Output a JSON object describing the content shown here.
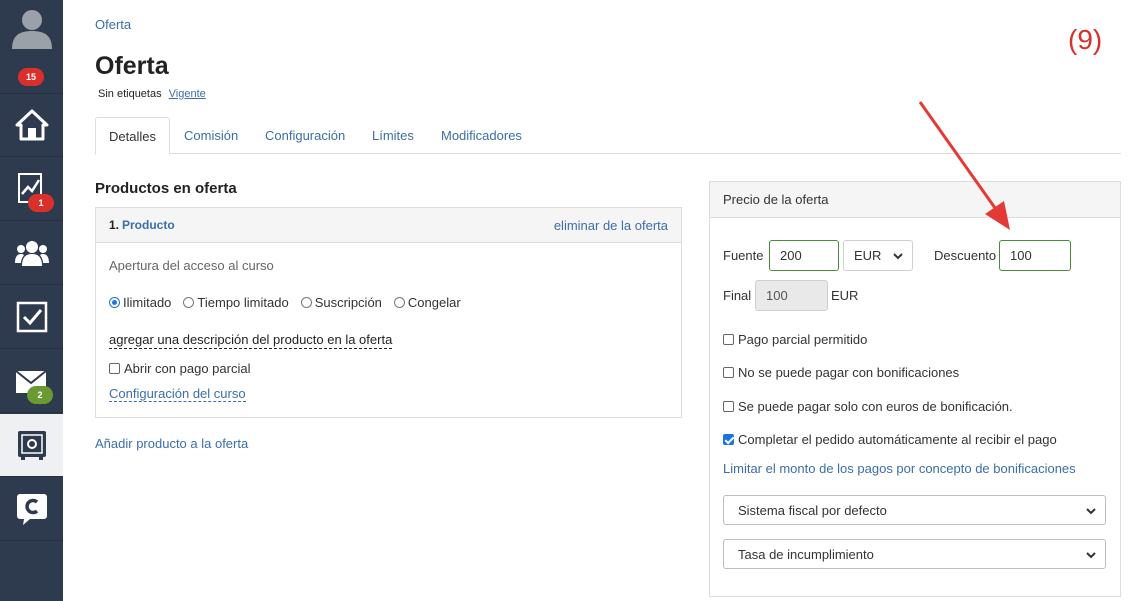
{
  "sidebar": {
    "items": [
      {
        "icon": "user-avatar-icon",
        "badge": "15",
        "badge_color": "#d9302c"
      },
      {
        "icon": "home-icon",
        "badge": ""
      },
      {
        "icon": "chart-trend-icon",
        "badge": "1",
        "badge_color": "#d9302c"
      },
      {
        "icon": "users-group-icon",
        "badge": ""
      },
      {
        "icon": "checkbox-task-icon",
        "badge": ""
      },
      {
        "icon": "envelope-icon",
        "badge": "2",
        "badge_color": "#6a9a32"
      },
      {
        "icon": "safe-icon",
        "badge": "",
        "active": true
      },
      {
        "icon": "chat-c-icon",
        "badge": ""
      }
    ]
  },
  "breadcrumb": "Oferta",
  "header": {
    "title": "Oferta",
    "tags": "Sin etiquetas",
    "status": "Vigente"
  },
  "annotation": "(9)",
  "tabs": [
    "Detalles",
    "Comisión",
    "Configuración",
    "Límites",
    "Modificadores"
  ],
  "products": {
    "section_title": "Productos en oferta",
    "item": {
      "number": "1.",
      "name": "Producto",
      "remove_label": "eliminar de la oferta",
      "access_label": "Apertura del acceso al curso",
      "access_options": [
        "Ilimitado",
        "Tiempo limitado",
        "Suscripción",
        "Congelar"
      ],
      "selected_option": "Ilimitado",
      "description_link": "agregar una descripción del producto en la oferta",
      "partial_payment_label": "Abrir con pago parcial",
      "partial_payment_checked": false,
      "course_settings_link": "Configuración del curso"
    },
    "add_product": "Añadir producto a la oferta"
  },
  "price": {
    "title": "Precio de la oferta",
    "source_label": "Fuente",
    "source_value": "200",
    "currency": "EUR",
    "discount_label": "Descuento",
    "discount_value": "100",
    "final_label": "Final",
    "final_value": "100",
    "final_currency": "EUR",
    "options": [
      {
        "label": "Pago parcial permitido",
        "checked": false
      },
      {
        "label": "No se puede pagar con bonificaciones",
        "checked": false
      },
      {
        "label": "Se puede pagar solo con euros de bonificación.",
        "checked": false
      },
      {
        "label": "Completar el pedido automáticamente al recibir el pago",
        "checked": true
      }
    ],
    "bonus_limit_link": "Limitar el monto de los pagos por concepto de bonificaciones",
    "tax_system": "Sistema fiscal por defecto",
    "default_rate": "Tasa de incumplimiento"
  },
  "colors": {
    "sidebar_bg": "#2e3b4e",
    "link": "#3b6ea8",
    "annotation": "#d9302c",
    "field_border": "#4a8a3a"
  }
}
